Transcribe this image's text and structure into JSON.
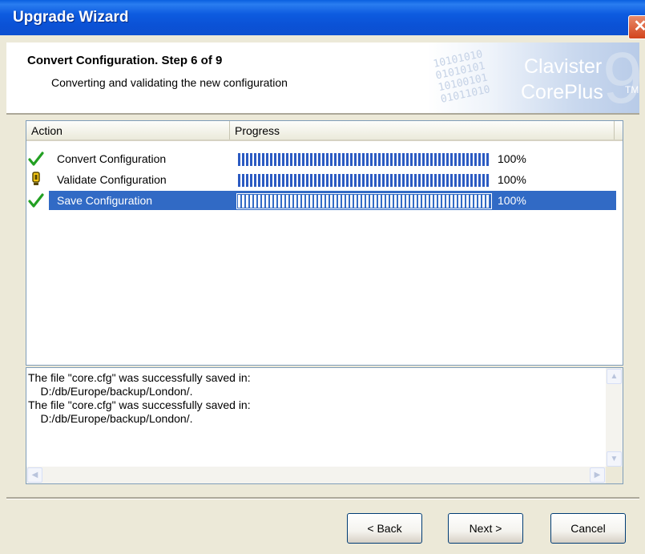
{
  "window": {
    "title": "Upgrade Wizard",
    "close_glyph": "✕"
  },
  "header": {
    "title": "Convert Configuration. Step 6 of 9",
    "subtitle": "Converting and validating the new configuration",
    "logo_line1": "Clavister",
    "logo_line2": "CorePlus",
    "logo_tm": "TM",
    "logo_numeral": "9",
    "logo_binary": "10101010\n01010101\n10100101\n01011010"
  },
  "table": {
    "columns": [
      "Action",
      "Progress"
    ],
    "rows": [
      {
        "label": "Convert Configuration",
        "progress": 1.0,
        "progress_text": "100%",
        "icon": "checkmark-icon",
        "selected": false
      },
      {
        "label": "Validate Configuration",
        "progress": 1.0,
        "progress_text": "100%",
        "icon": "warning-icon",
        "selected": false
      },
      {
        "label": "Save Configuration",
        "progress": 1.0,
        "progress_text": "100%",
        "icon": "checkmark-icon",
        "selected": true
      }
    ]
  },
  "log": {
    "text": "The file \"core.cfg\" was successfully saved in:\n    D:/db/Europe/backup/London/.\nThe file \"core.cfg\" was successfully saved in:\n    D:/db/Europe/backup/London/."
  },
  "buttons": {
    "back": "< Back",
    "next": "Next >",
    "cancel": "Cancel"
  },
  "colors": {
    "title_bar": "#0b52d6",
    "selection": "#316ac5",
    "progress_fill": "#2c5bc2",
    "dialog_bg": "#ece9d8"
  }
}
